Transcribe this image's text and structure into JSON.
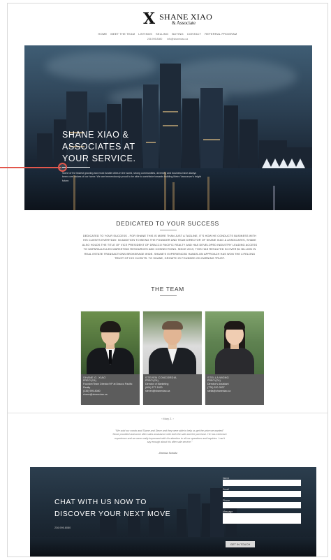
{
  "header": {
    "logo_mark": "X",
    "logo_name": "SHANE XIAO",
    "logo_sub": "& Associate",
    "nav": [
      "HOME",
      "MEET THE TEAM",
      "LISTINGS",
      "SELLING",
      "BUYING",
      "CONTACT",
      "REFERRAL PROGRAM"
    ],
    "phone": "236.995.8080",
    "email": "info@shanexiao.ca"
  },
  "hero": {
    "title": "SHANE XIAO & ASSOCIATES AT YOUR SERVICE.",
    "body": "Some of the fastest growing and most livable cities in the world, strong communities, diversity, and business have always been core values of our home. We are tremendously proud to be able to contribute towards building Metro Vancouver's bright future."
  },
  "dedicated": {
    "title": "DEDICATED TO YOUR SUCCESS",
    "body": "DEDICATED TO YOUR SUCCESS - FOR SHANE THIS IS MORE THAN JUST A TAGLINE, IT'S HOW HE CONDUCTS BUSINESS WITH HIS CLIENTS EVERYDAY. IN ADDITION TO BEING THE FOUNDER AND TEAM DIRECTOR OF SHANE XIAO & ASSOCIATES, SHANE ALSO HOLDS THE TITLE OF VICE PRESIDENT OF DRACCO PACIFIC REALTY AND HAS DEVELOPED INDUSTRY LEADING ACCESS TO UNPARALLELLED MARKETING RESOURCES AND CONNECTIONS. SINCE 2019, THIS HAS RESULTED IN OVER $1 BILLION IN REAL ESTATE TRANSACTIONS BROKERAGE WIDE. SHANE'S EXPERIENCED HANDS-ON APPROACH HAS WON THE LIFELONG TRUST OF HIS CLIENTS. TO SHANE, GROWTH IS FOUNDED ON EARNING TRUST."
  },
  "team": {
    "title": "THE TEAM",
    "members": [
      {
        "name": "SHANE G. XIAO",
        "cred": "PREC*(CA)",
        "role": "Founder/Team Director/VP at Dracco Pacific Realty",
        "phone": "(236) 995-8080",
        "email": "shane@shanexiao.ca"
      },
      {
        "name": "STEVEN CONCORDIA",
        "cred": "PREC*(CA)",
        "role": "Director of Marketing",
        "phone": "(604) 377-1820",
        "email": "steven@shanexiao.ca"
      },
      {
        "name": "STELLA WONG",
        "cred": "PREC*(CA)",
        "role": "Director's Assistant",
        "phone": "(778) 320-3537",
        "email": "stella@shanexiao.ca"
      }
    ]
  },
  "testimonial": {
    "nav": "‹ Mary Z. ›",
    "quote": "\"We sold our condo and Shane and Steve and they were able to help us get the price we wanted.\" Stone provided awesome after sales assistance with both the sale and the purchase. He has extensive experience and we were really impressed with his attention to all our questions and inquiries. I can't say enough about his after sale service.\"",
    "author": "- Brenda Schultz"
  },
  "chat": {
    "title": "CHAT WITH US NOW TO DISCOVER YOUR NEXT MOVE",
    "phone": "236.995.8080",
    "labels": {
      "name": "Name",
      "email": "Email",
      "phone": "Phone",
      "message": "Message"
    },
    "submit": "GET IN TOUCH"
  },
  "colors": {
    "accent": "#e2574c",
    "card_info": "#5c5c5c"
  }
}
